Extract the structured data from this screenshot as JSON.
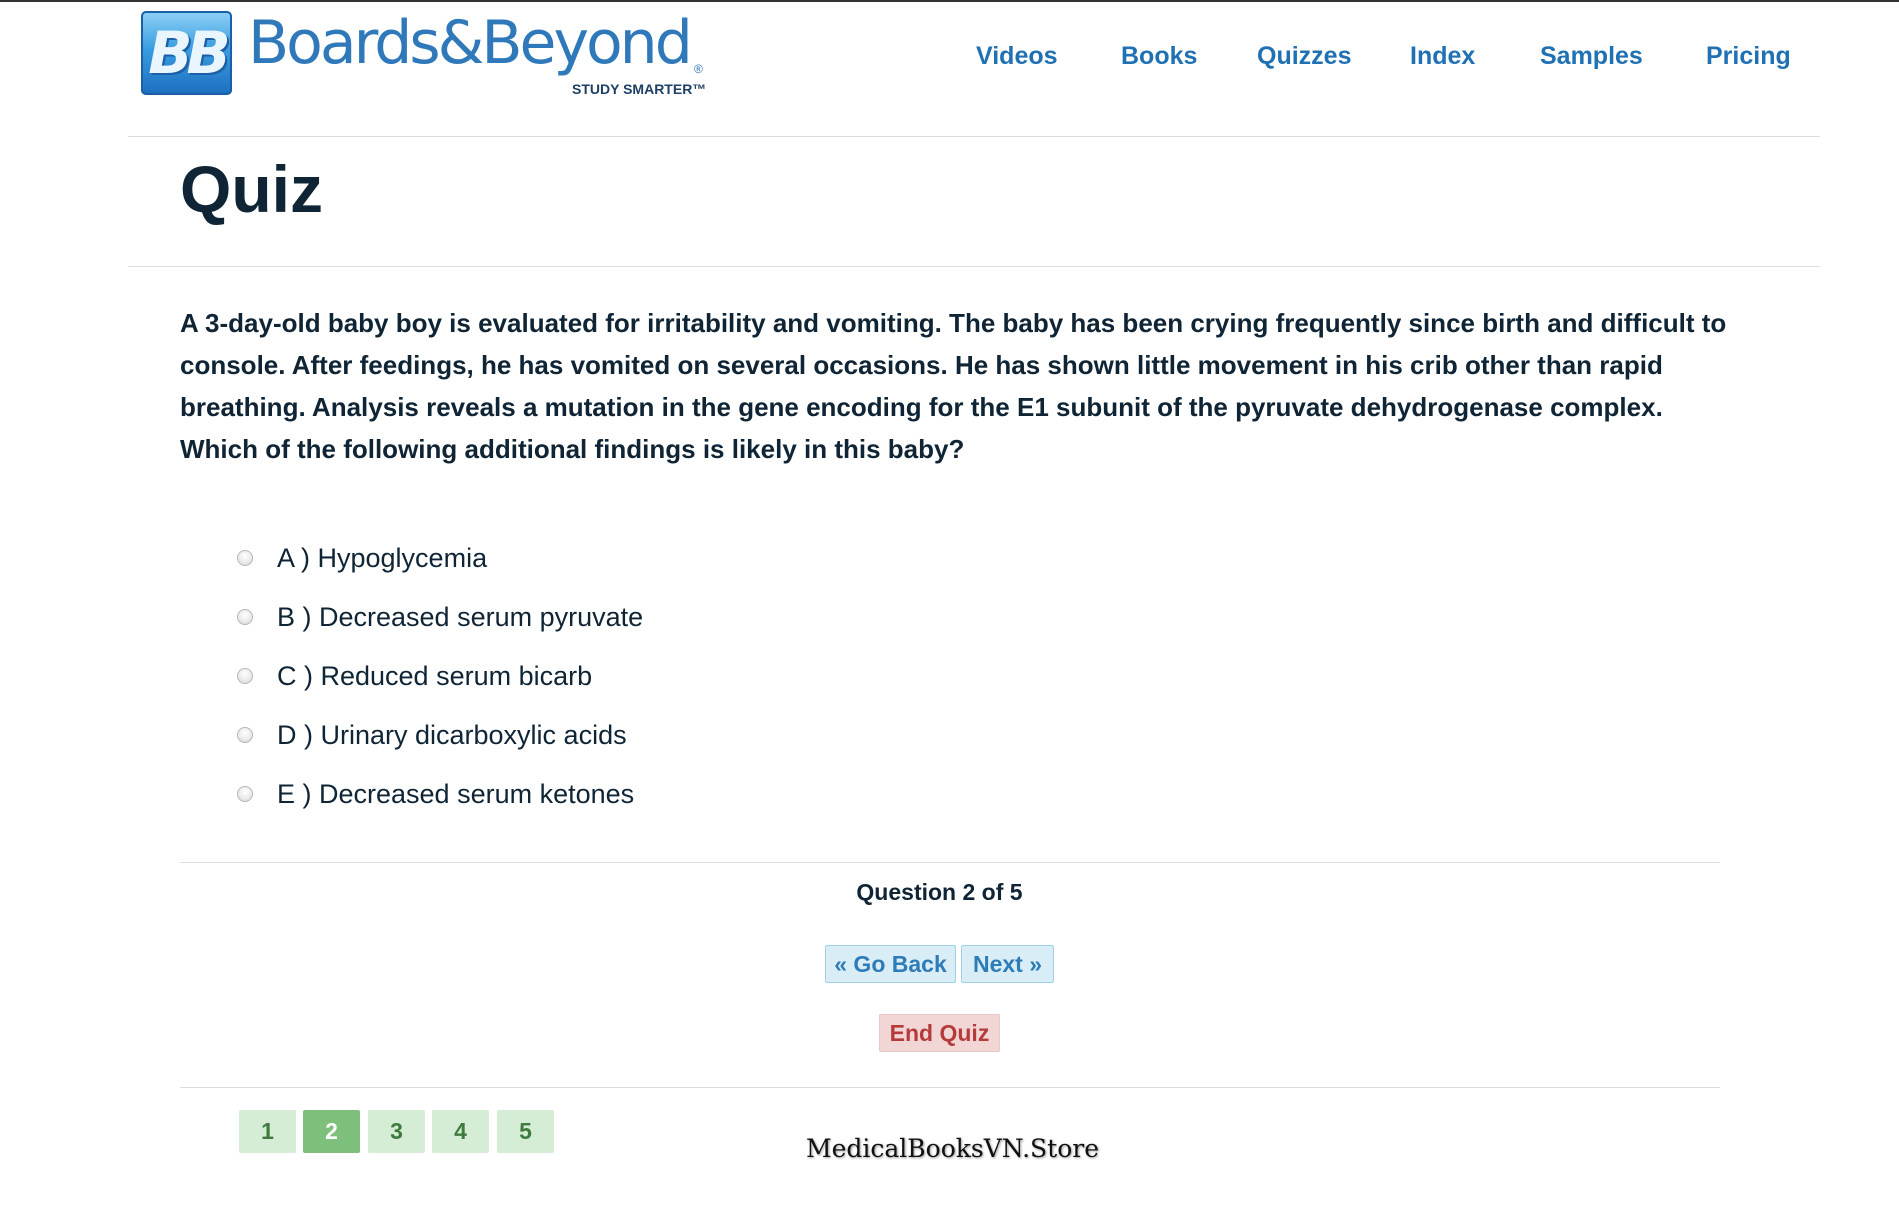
{
  "brand": {
    "badge_text": "BB",
    "name": "Boards&Beyond",
    "registered_mark": "®",
    "tagline": "STUDY SMARTER™"
  },
  "nav": {
    "items": [
      {
        "label": "Videos"
      },
      {
        "label": "Books"
      },
      {
        "label": "Quizzes"
      },
      {
        "label": "Index"
      },
      {
        "label": "Samples"
      },
      {
        "label": "Pricing"
      }
    ]
  },
  "page": {
    "title": "Quiz"
  },
  "question": {
    "text": "A 3-day-old baby boy is evaluated for irritability and vomiting. The baby has been crying frequently since birth and difficult to console. After feedings, he has vomited on several occasions. He has shown little movement in his crib other than rapid breathing. Analysis reveals a mutation in the gene encoding for the E1 subunit of the pyruvate dehydrogenase complex. Which of the following additional findings is likely in this baby?",
    "choices": [
      {
        "label": "A ) Hypoglycemia",
        "selected": false
      },
      {
        "label": "B ) Decreased serum pyruvate",
        "selected": false
      },
      {
        "label": "C ) Reduced serum bicarb",
        "selected": false
      },
      {
        "label": "D ) Urinary dicarboxylic acids",
        "selected": false
      },
      {
        "label": "E ) Decreased serum ketones",
        "selected": false
      }
    ]
  },
  "progress": {
    "text": "Question 2 of 5",
    "current": 2,
    "total": 5
  },
  "controls": {
    "back_label": "« Go Back",
    "next_label": "Next »",
    "end_label": "End Quiz"
  },
  "pager": {
    "pages": [
      "1",
      "2",
      "3",
      "4",
      "5"
    ],
    "active": "2"
  },
  "watermark": "MedicalBooksVN.Store",
  "colors": {
    "nav_link": "#1f71b4",
    "heading": "#0f2435",
    "nav_button_bg": "#d9edf7",
    "end_button_bg": "#f2d6d6",
    "pager_bg": "#d5ecd5",
    "pager_active_bg": "#7cc07c"
  }
}
